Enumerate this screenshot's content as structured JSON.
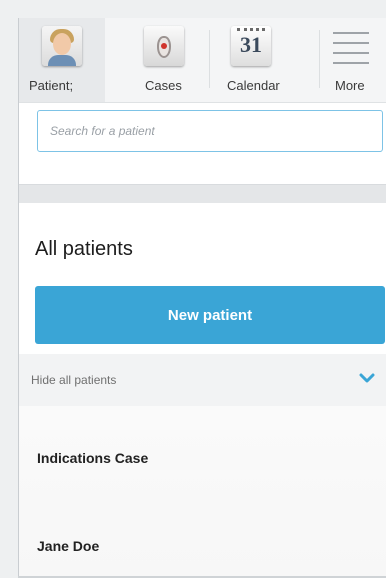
{
  "tabs": [
    {
      "label": "Patient;",
      "icon": "patient-photo-icon"
    },
    {
      "label": "Cases",
      "icon": "cases-icon"
    },
    {
      "label": "Calendar",
      "icon": "calendar-icon",
      "icon_text": "31"
    },
    {
      "label": "More",
      "icon": "menu-lines-icon"
    }
  ],
  "search": {
    "placeholder": "Search for a patient"
  },
  "section": {
    "title": "All patients"
  },
  "new_patient_button": {
    "label": "New patient"
  },
  "toggle": {
    "label": "Hide all patients"
  },
  "patients": [
    {
      "name": "Indications Case"
    },
    {
      "name": "Jane Doe"
    }
  ],
  "colors": {
    "accent": "#3aa5d6",
    "search_border": "#7dc3e6"
  }
}
